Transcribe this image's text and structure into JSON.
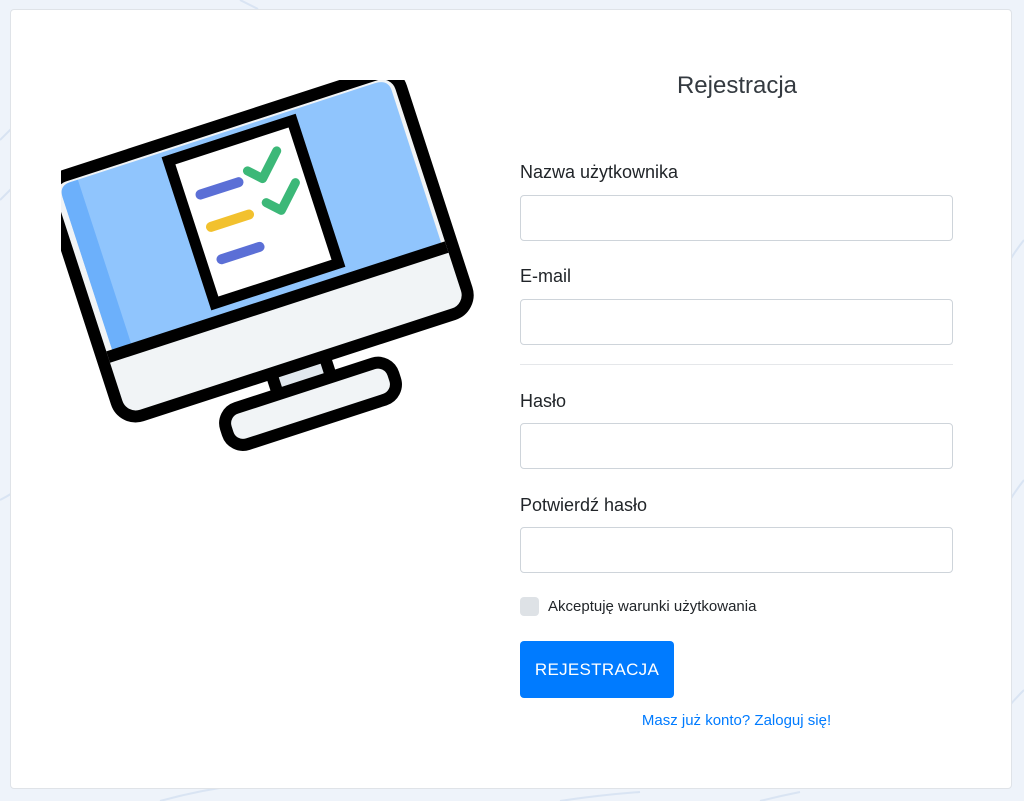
{
  "form": {
    "title": "Rejestracja",
    "username": {
      "label": "Nazwa użytkownika",
      "value": "",
      "placeholder": ""
    },
    "email": {
      "label": "E-mail",
      "value": "",
      "placeholder": ""
    },
    "password": {
      "label": "Hasło",
      "value": "",
      "placeholder": ""
    },
    "confirm_password": {
      "label": "Potwierdź hasło",
      "value": "",
      "placeholder": ""
    },
    "terms": {
      "label": "Akceptuję warunki użytkowania",
      "checked": false
    },
    "submit_label": "REJESTRACJA",
    "login_link": "Masz już konto? Zaloguj się!"
  },
  "illustration": {
    "icon": "monitor-checklist-icon",
    "colors": {
      "screen": "#90c5fd",
      "screen_shadow": "#6cb0fb",
      "bezel": "#f1f4f6",
      "outline": "#000000",
      "check": "#3cb878",
      "line_blue": "#5b6fd6",
      "line_yellow": "#f2c12e"
    }
  },
  "colors": {
    "primary": "#007bff",
    "background": "#eef3fa",
    "card": "#ffffff",
    "checkbox": "#dee2e6"
  }
}
